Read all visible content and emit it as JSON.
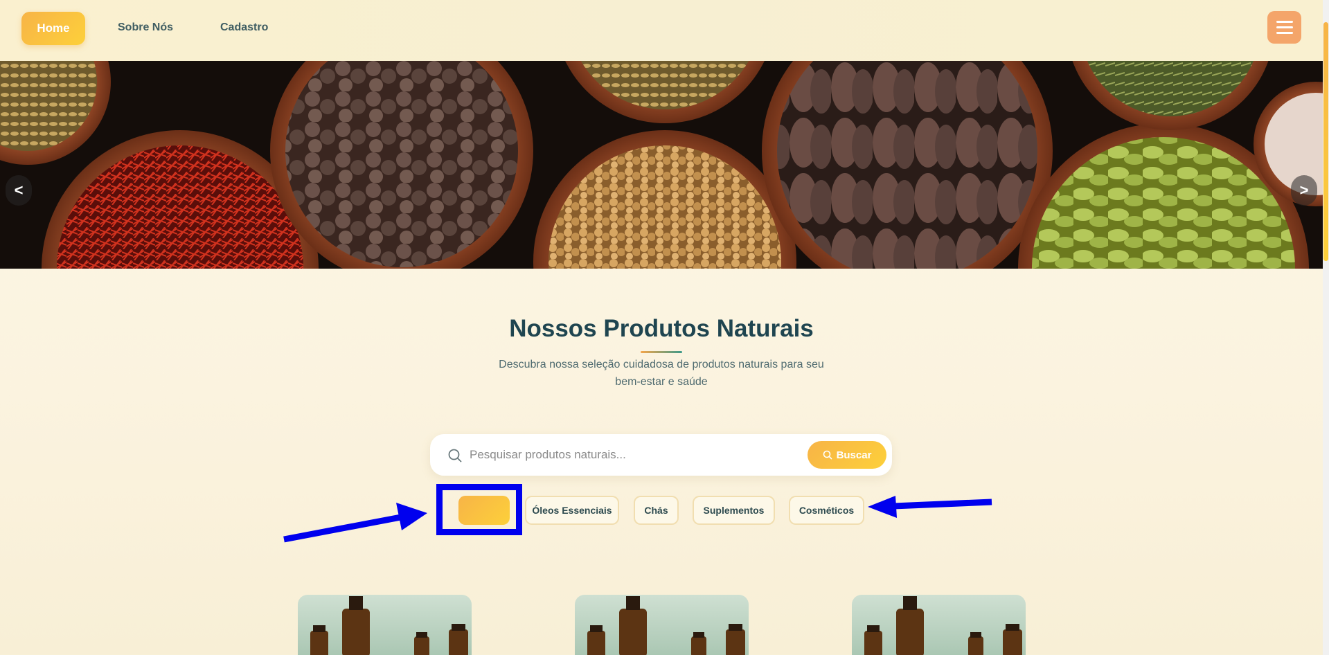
{
  "nav": {
    "items": [
      {
        "label": "Home",
        "active": true
      },
      {
        "label": "Sobre Nós"
      },
      {
        "label": "Cadastro"
      }
    ],
    "menu_icon": "hamburger-icon"
  },
  "hero": {
    "prev_label": "<",
    "next_label": ">"
  },
  "products": {
    "title": "Nossos Produtos Naturais",
    "subtitle": "Descubra nossa seleção cuidadosa de produtos naturais para seu bem-estar e saúde"
  },
  "search": {
    "placeholder": "Pesquisar produtos naturais...",
    "value": "",
    "button_label": "Buscar"
  },
  "filters": [
    {
      "label": "",
      "active": true
    },
    {
      "label": "Óleos Essenciais"
    },
    {
      "label": "Chás"
    },
    {
      "label": "Suplementos"
    },
    {
      "label": "Cosméticos"
    }
  ],
  "colors": {
    "accent": "#f7b447",
    "accent_light": "#fdd03a",
    "title": "#1f4550",
    "annotation": "#0000ee"
  }
}
